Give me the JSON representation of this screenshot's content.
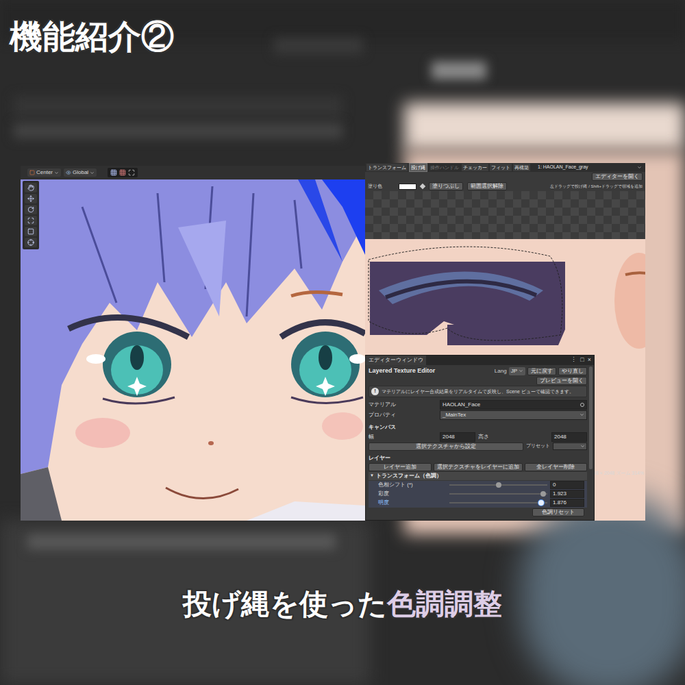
{
  "title": "機能紹介②",
  "caption": [
    {
      "text": "投げ縄を使った",
      "color": "#ffffff"
    },
    {
      "text": "色調調整",
      "color": "#ddcde6"
    }
  ],
  "scene_view": {
    "pivot": "Center",
    "space": "Global"
  },
  "texture_editor": {
    "tabs": [
      {
        "label": "トランスフォーム",
        "selected": false,
        "disabled": false
      },
      {
        "label": "投げ縄",
        "selected": true,
        "disabled": false
      },
      {
        "label": "操作ハンドル",
        "selected": false,
        "disabled": true
      },
      {
        "label": "チェッカー",
        "selected": false,
        "disabled": false
      },
      {
        "label": "フィット",
        "selected": false,
        "disabled": false
      },
      {
        "label": "再構築",
        "selected": false,
        "disabled": false
      }
    ],
    "layer_select": "1: HAOLAN_Face_gray",
    "open_editor_button": "エディターを開く",
    "fill_color_label": "塗り色",
    "fill_color": "#ffffff",
    "fill_button": "塗りつぶし",
    "deselect_button": "範囲選択解除",
    "hint": "左ドラッグで投げ縄 / Shift+ドラッグで領域を追加",
    "status": "048 × 2048  ズーム 314%"
  },
  "editor_window": {
    "tab": "エディターウィンドウ",
    "controls": [
      "⋮",
      "□",
      "×"
    ],
    "heading": "Layered Texture Editor",
    "lang_label": "Lang",
    "lang_value": "JP",
    "undo_button": "元に戻す",
    "redo_button": "やり直し",
    "preview_button": "プレビューを開く",
    "info_icon": "!",
    "info": "マテリアルにレイヤー合成結果をリアルタイムで反映し、Scene ビューで確認できます。",
    "material_label": "マテリアル",
    "material_value": "HAOLAN_Face",
    "property_label": "プロパティ",
    "property_value": "_MainTex",
    "canvas_heading": "キャンバス",
    "width_label": "幅",
    "width_value": "2048",
    "height_label": "高さ",
    "height_value": "2048",
    "set_from_texture_button": "選択テクスチャから設定",
    "preset_label": "プリセット",
    "layers_heading": "レイヤー",
    "layer_buttons": [
      "レイヤー追加",
      "選択テクスチャをレイヤーに追加",
      "全レイヤー削除"
    ],
    "foldout": {
      "arrow": "▼",
      "label": "トランスフォーム（色調）",
      "expanded": true
    },
    "sliders": [
      {
        "label": "色相シフト (*)",
        "value": "0",
        "level": 0.5,
        "selected": false
      },
      {
        "label": "彩度",
        "value": "1.923",
        "level": 0.96,
        "selected": false
      },
      {
        "label": "明度",
        "value": "1.876",
        "level": 0.94,
        "selected": true
      }
    ],
    "reset_button": "色調リセット"
  }
}
